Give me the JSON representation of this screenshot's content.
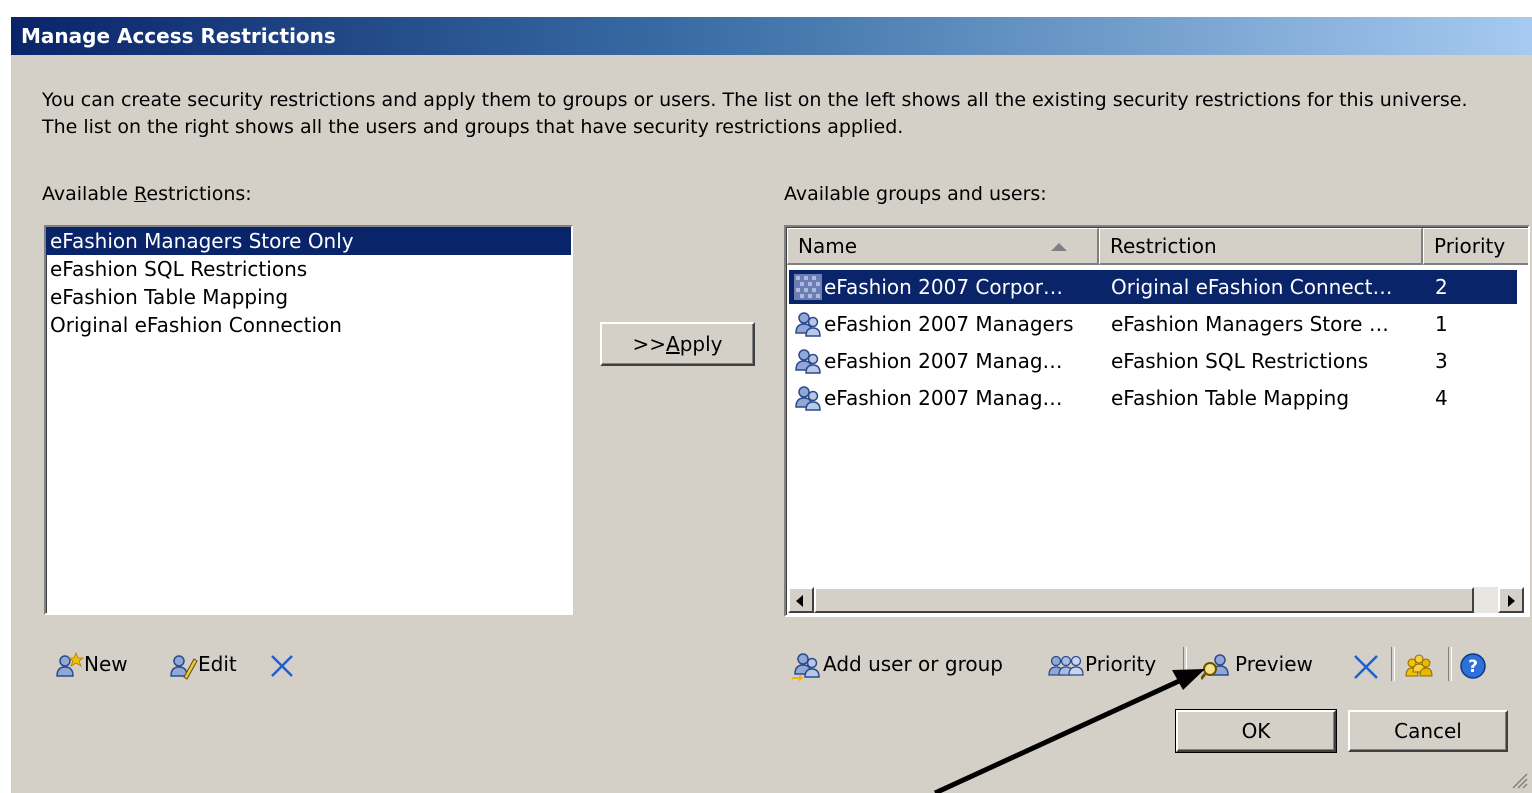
{
  "dialog": {
    "title": "Manage Access Restrictions",
    "description": "You can create security restrictions and apply them to groups or users. The list on the left shows all the existing security restrictions for this universe.  The list on the right shows all the users and groups that have security restrictions applied."
  },
  "restrictions": {
    "label_pre": "Available ",
    "label_accel": "R",
    "label_post": "estrictions:",
    "items": [
      "eFashion Managers Store Only",
      "eFashion SQL Restrictions",
      "eFashion Table Mapping",
      "Original eFashion Connection"
    ],
    "selected_index": 0
  },
  "apply_button": {
    "pre": ">>",
    "accel": "A",
    "post": "pply"
  },
  "groups": {
    "label_pre": "Available ",
    "label_accel": "g",
    "label_post": "roups and users:",
    "columns": [
      "Name",
      "Restriction",
      "Priority"
    ],
    "sort_column": "Name",
    "rows": [
      {
        "name": "eFashion 2007 Corpor…",
        "restriction": "Original eFashion Connect…",
        "priority": "2",
        "selected": true
      },
      {
        "name": "eFashion 2007 Managers",
        "restriction": "eFashion Managers Store …",
        "priority": "1",
        "selected": false
      },
      {
        "name": "eFashion 2007 Manag…",
        "restriction": "eFashion SQL Restrictions",
        "priority": "3",
        "selected": false
      },
      {
        "name": "eFashion 2007 Manag…",
        "restriction": "eFashion Table Mapping",
        "priority": "4",
        "selected": false
      }
    ]
  },
  "left_toolbar": {
    "new_label": "New",
    "edit_label": "Edit"
  },
  "right_toolbar": {
    "add_label": "Add user or group",
    "priority_label": "Priority",
    "preview_label": "Preview"
  },
  "footer": {
    "ok_label": "OK",
    "cancel_label": "Cancel"
  },
  "colors": {
    "selection": "#0a246a",
    "dialog_bg": "#d4d0c8",
    "delete_x": "#1f5fd1"
  }
}
